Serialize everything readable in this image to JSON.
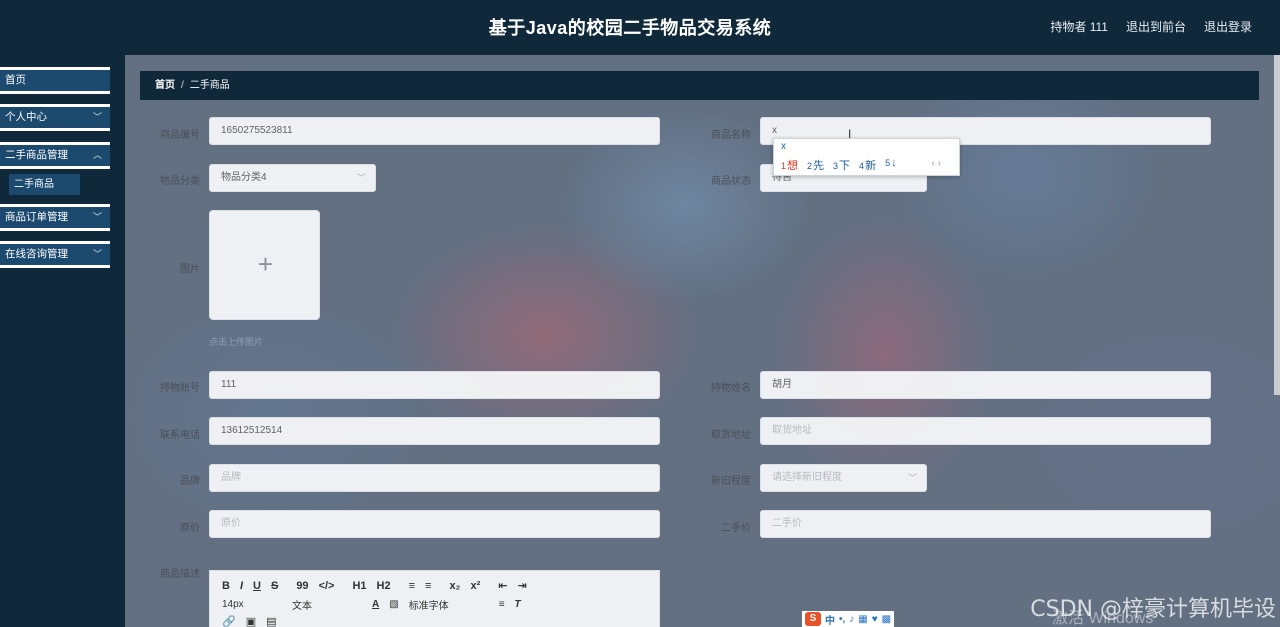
{
  "header": {
    "title": "基于Java的校园二手物品交易系统",
    "user_label": "持物者 111",
    "back_front_label": "退出到前台",
    "logout_label": "退出登录"
  },
  "sidebar": {
    "items": [
      {
        "label": "首页",
        "has_arrow": false
      },
      {
        "label": "个人中心",
        "has_arrow": true
      },
      {
        "label": "二手商品管理",
        "has_arrow": true
      },
      {
        "label": "商品订单管理",
        "has_arrow": true
      },
      {
        "label": "在线咨询管理",
        "has_arrow": true
      }
    ],
    "submenu_label": "二手商品",
    "arrow_icon": "chevron-down-icon"
  },
  "breadcrumb": {
    "home": "首页",
    "separator": "/",
    "current": "二手商品"
  },
  "form": {
    "item_no": {
      "label": "商品编号",
      "value": "1650275523811"
    },
    "item_name": {
      "label": "商品名称",
      "value": "x"
    },
    "category": {
      "label": "物品分类",
      "value": "物品分类4"
    },
    "status": {
      "label": "商品状态",
      "value": "待售"
    },
    "image": {
      "label": "图片",
      "hint": "点击上传图片"
    },
    "holder_account": {
      "label": "持物账号",
      "value": "111"
    },
    "holder_name": {
      "label": "持物姓名",
      "value": "胡月"
    },
    "phone": {
      "label": "联系电话",
      "value": "13612512514"
    },
    "pickup_address": {
      "label": "取货地址",
      "placeholder": "取货地址"
    },
    "brand": {
      "label": "品牌",
      "placeholder": "品牌"
    },
    "condition": {
      "label": "新旧程度",
      "placeholder": "请选择新旧程度"
    },
    "original_price": {
      "label": "原价",
      "placeholder": "原价"
    },
    "second_price": {
      "label": "二手价",
      "placeholder": "二手价"
    },
    "description": {
      "label": "商品描述"
    }
  },
  "editor": {
    "row1": [
      "B",
      "I",
      "U",
      "S",
      "99",
      "</>",
      "H1",
      "H2",
      "≡",
      "≡",
      "x₂",
      "x²",
      "⇤",
      "⇥"
    ],
    "font_size": "14px",
    "paragraph": "文本",
    "font_family": "标准字体"
  },
  "ime": {
    "typed": "x",
    "candidates": [
      {
        "n": "1",
        "w": "想"
      },
      {
        "n": "2",
        "w": "先"
      },
      {
        "n": "3",
        "w": "下"
      },
      {
        "n": "4",
        "w": "新"
      },
      {
        "n": "5",
        "w": "↓"
      }
    ],
    "pager": "‹ ›",
    "bar_mode": "中",
    "logo": "S"
  },
  "overlay": {
    "watermark": "CSDN @梓豪计算机毕设",
    "activate": "激活 Windows"
  },
  "colors": {
    "header_bg": "#10293a",
    "menu_bg": "#1c4a6e",
    "ime_highlight": "#d9351f"
  }
}
